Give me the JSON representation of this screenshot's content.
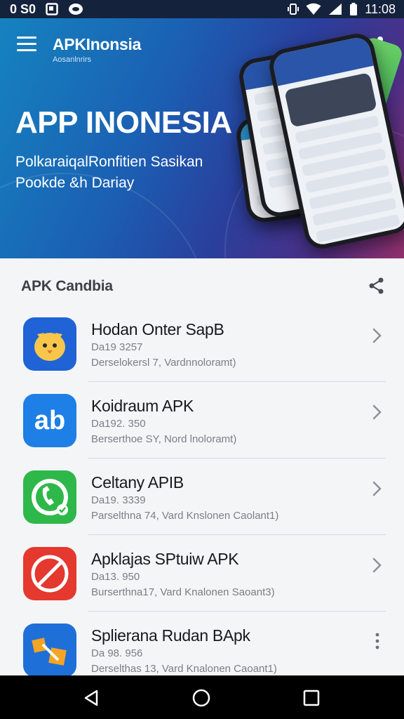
{
  "status_bar": {
    "left_text": "0 S0",
    "time": "11:08",
    "icons": [
      "notification-icon",
      "photo-icon",
      "chat-icon",
      "vibrate-icon",
      "wifi-icon",
      "signal-icon",
      "battery-icon"
    ]
  },
  "header": {
    "brand_title": "APKInonsia",
    "brand_subtitle": "Aosanlnrirs",
    "hero_title": "APP INONESIA",
    "hero_subtitle_line1": "PolkaraiqalRonfitien Sasikan",
    "hero_subtitle_line2": "Pookde &h Dariay",
    "icons": [
      "menu-icon",
      "share-icon"
    ]
  },
  "section": {
    "title": "APK Candbia",
    "icon": "share-icon"
  },
  "apps": [
    {
      "name": "Hodan Onter SapB",
      "meta1": "Da19 3257",
      "meta2": "Derselokersl 7, Vardnnoloramt)",
      "icon": "chick-icon",
      "icon_color": "#1f63d6",
      "action": "chevron-right-icon"
    },
    {
      "name": "Koidraum APK",
      "meta1": "Da192. 350",
      "meta2": "Berserthoe SY, Nord lnoloramt)",
      "icon": "ab-icon",
      "icon_color": "#1e7fe6",
      "action": "chevron-right-icon"
    },
    {
      "name": "Celtany APIB",
      "meta1": "Da19. 3339",
      "meta2": "Parselthna 74, Vard Knslonen Caolant1)",
      "icon": "phone-icon",
      "icon_color": "#2eb84a",
      "action": "chevron-right-icon"
    },
    {
      "name": "Apklajas SPtuiw APK",
      "meta1": "Da13. 950",
      "meta2": "Burserthna17, Vard Knalonen Saoant3)",
      "icon": "no-pencil-icon",
      "icon_color": "#e5382e",
      "action": "chevron-right-icon"
    },
    {
      "name": "Splierana Rudan BApk",
      "meta1": "Da 98. 956",
      "meta2": "Derselthas 13, Vard Knalonen Caoant1)",
      "icon": "puzzle-icon",
      "icon_color": "#1f6fd8",
      "action": "more-vert-icon"
    }
  ],
  "nav_bar": {
    "icons": [
      "back-icon",
      "home-icon",
      "recents-icon"
    ]
  },
  "colors": {
    "status_bar": "#15223c",
    "hero_start": "#1583bf",
    "hero_end": "#93306c",
    "background": "#f4f5f7"
  }
}
